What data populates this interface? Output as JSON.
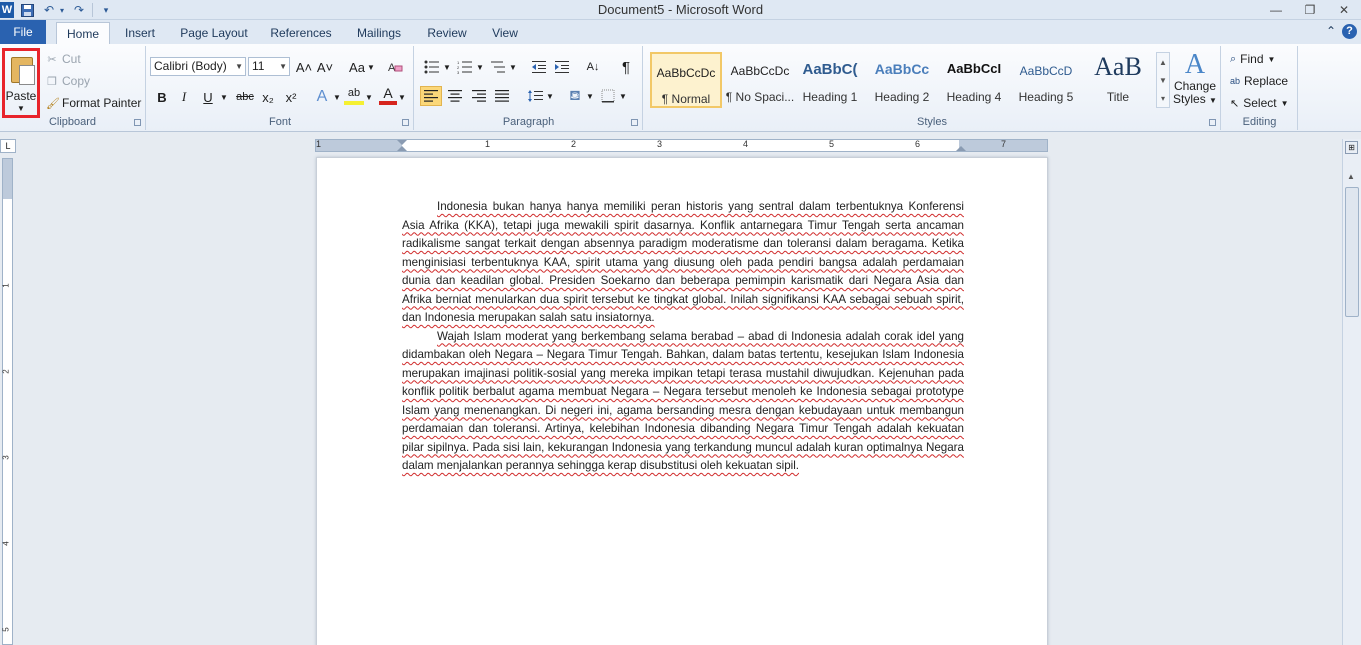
{
  "window": {
    "title": "Document5  -  Microsoft Word",
    "app_logo": "W",
    "controls": [
      "—",
      "❐",
      "✕"
    ]
  },
  "qat": {
    "save_icon": "💾",
    "undo_icon": "↶",
    "redo_icon": "↷",
    "customize_icon": "▾"
  },
  "tabs": [
    {
      "label": "File"
    },
    {
      "label": "Home"
    },
    {
      "label": "Insert"
    },
    {
      "label": "Page Layout"
    },
    {
      "label": "References"
    },
    {
      "label": "Mailings"
    },
    {
      "label": "Review"
    },
    {
      "label": "View"
    }
  ],
  "help": {
    "minimize_icon": "⌃",
    "help_icon": "?"
  },
  "clipboard": {
    "paste": "Paste",
    "cut": "Cut",
    "copy": "Copy",
    "format_painter": "Format Painter",
    "label": "Clipboard"
  },
  "font": {
    "family": "Calibri (Body)",
    "size": "11",
    "grow": "A˄",
    "shrink": "A˅",
    "change_case": "Aa",
    "bold": "B",
    "italic": "I",
    "underline": "U",
    "strikethrough": "abc",
    "subscript": "x₂",
    "superscript": "x²",
    "text_effects": "A",
    "highlight": "ab",
    "font_color": "A",
    "label": "Font"
  },
  "paragraph": {
    "pilcrow": "¶",
    "sort": "A↓",
    "label": "Paragraph"
  },
  "styles": {
    "items": [
      {
        "sample": "AaBbCcDc",
        "name": "¶ Normal"
      },
      {
        "sample": "AaBbCcDc",
        "name": "¶ No Spaci..."
      },
      {
        "sample": "AaBbC(",
        "name": "Heading 1"
      },
      {
        "sample": "AaBbCc",
        "name": "Heading 2"
      },
      {
        "sample": "AaBbCcI",
        "name": "Heading 4"
      },
      {
        "sample": "AaBbCcD",
        "name": "Heading 5"
      },
      {
        "sample": "AaB",
        "name": "Title"
      }
    ],
    "change_styles_line1": "Change",
    "change_styles_line2": "Styles",
    "label": "Styles"
  },
  "editing": {
    "find": "Find",
    "replace": "Replace",
    "select": "Select",
    "label": "Editing"
  },
  "ruler": {
    "numbers": [
      "1",
      "1",
      "2",
      "3",
      "4",
      "5",
      "6",
      "7"
    ],
    "vnumbers": [
      "1",
      "2",
      "3",
      "4",
      "5"
    ]
  },
  "document": {
    "paragraphs": [
      "Indonesia bukan hanya hanya memiliki peran historis yang sentral dalam terbentuknya Konferensi Asia Afrika (KKA), tetapi juga mewakili spirit dasarnya. Konflik antarnegara Timur Tengah serta ancaman radikalisme sangat terkait dengan absennya paradigm moderatisme dan toleransi dalam beragama. Ketika menginisiasi terbentuknya KAA, spirit utama yang diusung oleh pada pendiri bangsa adalah perdamaian dunia dan keadilan global. Presiden Soekarno dan beberapa pemimpin karismatik dari Negara Asia dan Afrika berniat menularkan dua spirit tersebut ke tingkat global. Inilah signifikansi KAA sebagai sebuah spirit, dan Indonesia merupakan salah satu insiatornya.",
      "Wajah Islam moderat yang berkembang selama berabad – abad di Indonesia adalah corak idel yang didambakan oleh Negara – Negara Timur Tengah. Bahkan, dalam batas tertentu, kesejukan Islam Indonesia merupakan imajinasi politik-sosial yang mereka impikan tetapi terasa mustahil diwujudkan. Kejenuhan pada konflik politik berbalut agama membuat Negara – Negara tersebut menoleh ke Indonesia sebagai prototype Islam yang menenangkan. Di negeri ini, agama bersanding mesra dengan kebudayaan untuk membangun perdamaian dan toleransi. Artinya, kelebihan Indonesia dibanding Negara Timur Tengah adalah kekuatan pilar sipilnya. Pada sisi lain, kekurangan Indonesia yang terkandung muncul adalah kuran optimalnya Negara dalam menjalankan perannya sehingga kerap disubstitusi oleh kekuatan sipil."
    ]
  },
  "colors": {
    "file_tab": "#2a62b0",
    "highlight_box": "#e8242b",
    "spell_underline": "#d02b2b"
  }
}
